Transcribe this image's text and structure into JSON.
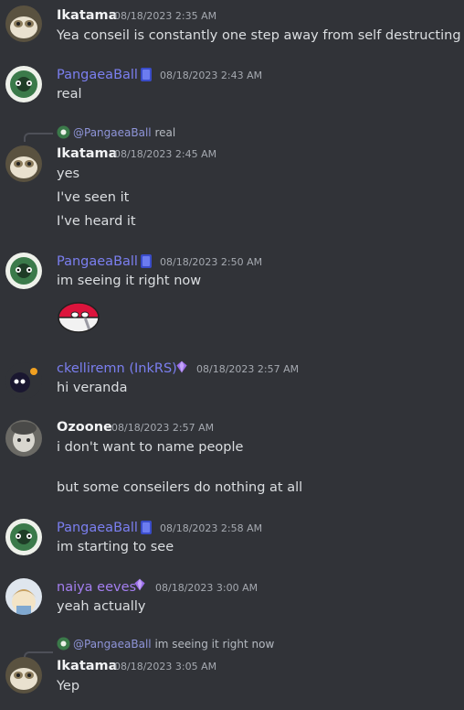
{
  "messages": [
    {
      "author": "Ikatama",
      "timestamp": "08/18/2023 2:35 AM",
      "lines": [
        "Yea conseil is constantly one step away from self destructing"
      ]
    },
    {
      "author": "PangaeaBall",
      "timestamp": "08/18/2023 2:43 AM",
      "lines": [
        "real"
      ]
    },
    {
      "reply_mention": "@PangaeaBall",
      "reply_text": "real",
      "author": "Ikatama",
      "timestamp": "08/18/2023 2:45 AM",
      "lines": [
        "yes",
        "I've seen it",
        "I've heard it"
      ]
    },
    {
      "author": "PangaeaBall",
      "timestamp": "08/18/2023 2:50 AM",
      "lines": [
        "im seeing it right now"
      ]
    },
    {
      "author": "ckelliremn (InkRS)",
      "timestamp": "08/18/2023 2:57 AM",
      "lines": [
        "hi veranda"
      ]
    },
    {
      "author": "Ozoone",
      "timestamp": "08/18/2023 2:57 AM",
      "lines": [
        "i don't want to name people",
        "but some conseilers do nothing at all"
      ]
    },
    {
      "author": "PangaeaBall",
      "timestamp": "08/18/2023 2:58 AM",
      "lines": [
        "im starting to see"
      ]
    },
    {
      "author": "naiya eeves",
      "timestamp": "08/18/2023 3:00 AM",
      "lines": [
        "yeah actually"
      ]
    },
    {
      "reply_mention": "@PangaeaBall",
      "reply_text": "im seeing it right now",
      "author": "Ikatama",
      "timestamp": "08/18/2023 3:05 AM",
      "lines": [
        "Yep"
      ]
    }
  ],
  "colors": {
    "background": "#313338",
    "blue_name": "#7b7ff0",
    "purple_name": "#a47ff0",
    "text": "#dbdee1",
    "timestamp": "#a5a9b0"
  }
}
